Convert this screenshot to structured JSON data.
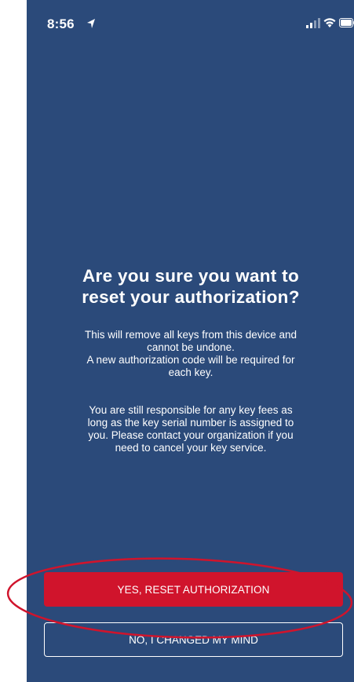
{
  "status_bar": {
    "time": "8:56",
    "icons": [
      "location-arrow-icon",
      "signal-icon",
      "wifi-icon",
      "battery-icon"
    ]
  },
  "dialog": {
    "title_line1": "Are you sure you want to",
    "title_line2": "reset your authorization?",
    "paragraph1": [
      "This will remove all keys from this device and",
      "cannot be undone.",
      "A new authorization code will be required for",
      "each key."
    ],
    "paragraph2": [
      "You are still responsible for any key fees as",
      "long as the key serial number is assigned to",
      "you. Please contact your organization if you",
      "need to cancel your key service."
    ]
  },
  "buttons": {
    "confirm_label": "YES, RESET AUTHORIZATION",
    "cancel_label": "NO, I CHANGED MY MIND"
  },
  "colors": {
    "background": "#2b4a7a",
    "confirm_button": "#d0142c",
    "highlight_annotation": "#d0142c",
    "text": "#ffffff"
  }
}
